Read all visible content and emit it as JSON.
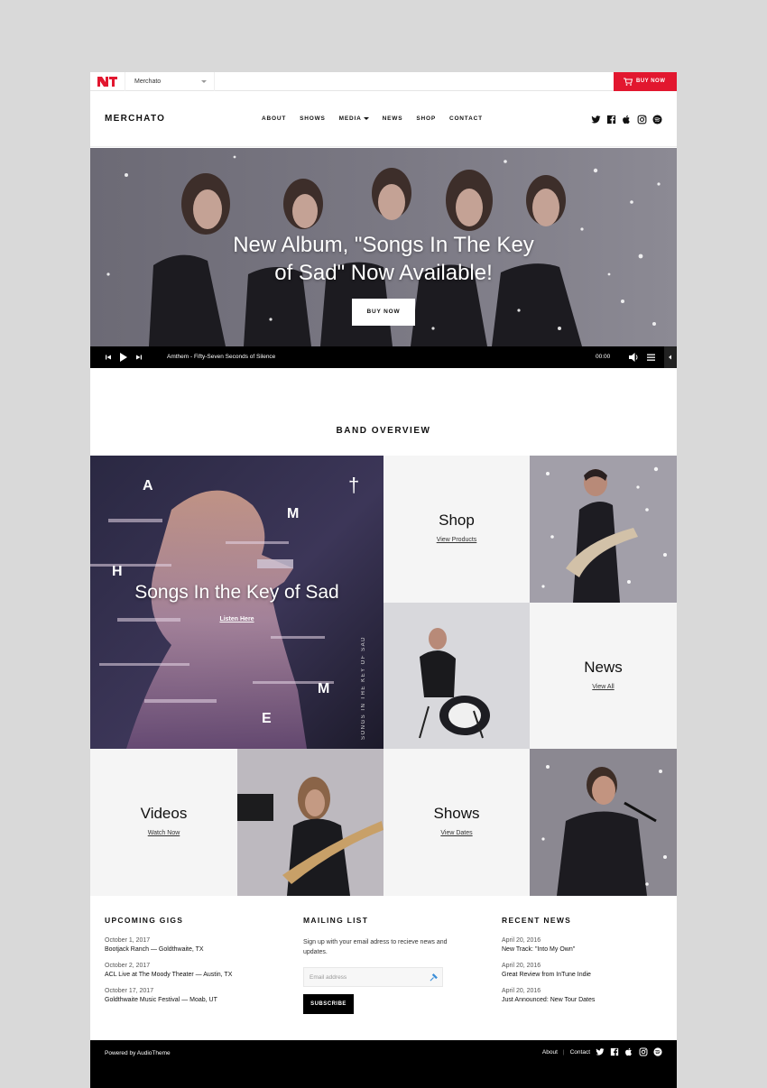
{
  "switcher": {
    "theme_name": "Merchato",
    "buy_label": "BUY NOW"
  },
  "header": {
    "brand": "MERCHATO",
    "nav": [
      "ABOUT",
      "SHOWS",
      "MEDIA",
      "NEWS",
      "SHOP",
      "CONTACT"
    ],
    "social_icons": [
      "twitter-icon",
      "facebook-icon",
      "apple-icon",
      "instagram-icon",
      "spotify-icon"
    ]
  },
  "hero": {
    "title_line1": "New Album, \"Songs In The Key",
    "title_line2": "of Sad\" Now Available!",
    "button": "BUY NOW"
  },
  "player": {
    "track": "Amthem - Fifty-Seven Seconds of Silence",
    "time": "00:00"
  },
  "overview": {
    "title": "BAND OVERVIEW"
  },
  "feature": {
    "title": "Songs In the Key of Sad",
    "link": "Listen Here",
    "side_text": "SONGS IN THE KEY OF SAD",
    "letters": [
      "A",
      "†",
      "M",
      "H",
      "M",
      "E"
    ]
  },
  "tiles": {
    "shop": {
      "title": "Shop",
      "link": "View Products"
    },
    "news": {
      "title": "News",
      "link": "View All"
    },
    "videos": {
      "title": "Videos",
      "link": "Watch Now"
    },
    "shows": {
      "title": "Shows",
      "link": "View Dates"
    }
  },
  "gigs": {
    "title": "UPCOMING GIGS",
    "items": [
      {
        "date": "October 1, 2017",
        "name": "Bootjack Ranch — Goldthwaite, TX"
      },
      {
        "date": "October 2, 2017",
        "name": "ACL Live at The Moody Theater — Austin, TX"
      },
      {
        "date": "October 17, 2017",
        "name": "Goldthwaite Music Festival — Moab, UT"
      }
    ]
  },
  "mailing": {
    "title": "MAILING LIST",
    "text": "Sign up with your email adress to recieve news and updates.",
    "placeholder": "Email address",
    "button": "SUBSCRIBE"
  },
  "news": {
    "title": "RECENT NEWS",
    "items": [
      {
        "date": "April 20, 2016",
        "name": "New Track: \"Into My Own\""
      },
      {
        "date": "April 20, 2016",
        "name": "Great Review from InTune Indie"
      },
      {
        "date": "April 20, 2016",
        "name": "Just Announced: New Tour Dates"
      }
    ]
  },
  "footer": {
    "powered": "Powered by AudioTheme",
    "about": "About",
    "sep": "|",
    "contact": "Contact"
  }
}
